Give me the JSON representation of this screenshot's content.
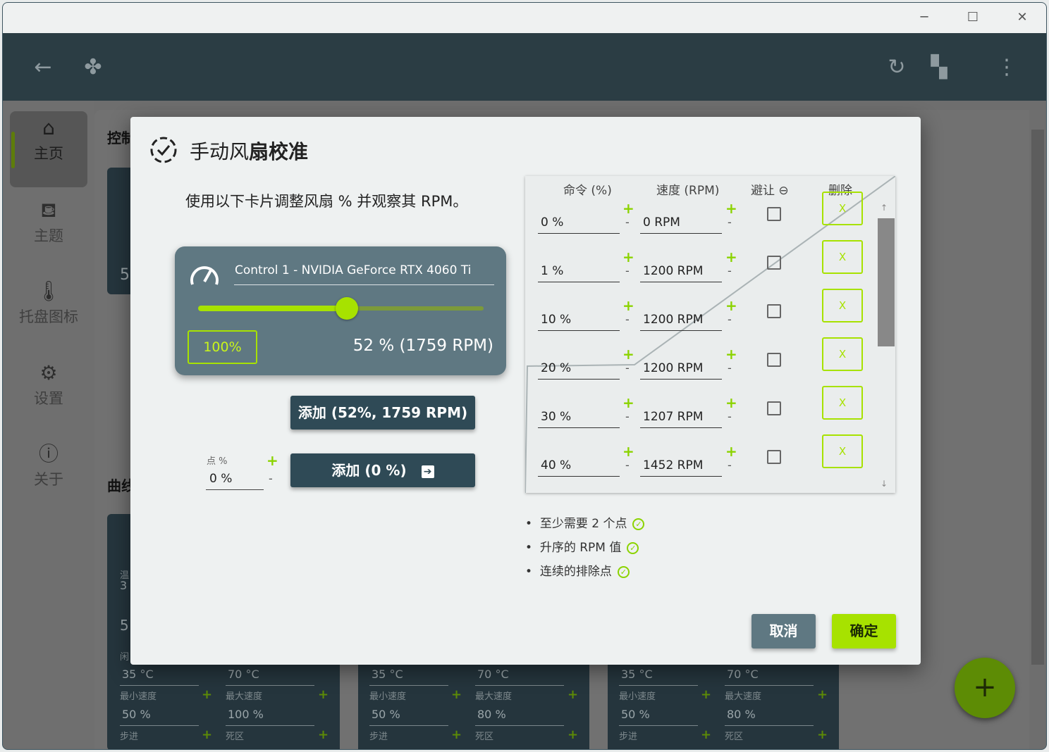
{
  "window": {
    "minimize_icon": "minimize-icon",
    "maximize_icon": "maximize-icon",
    "close_icon": "close-icon"
  },
  "appbar": {
    "back_icon": "arrow-left-icon",
    "app_icon": "fan-icon",
    "refresh_icon": "refresh-icon",
    "dashboard_icon": "dashboard-edit-icon",
    "more_icon": "more-vertical-icon"
  },
  "sidebar": {
    "items": [
      {
        "label": "主页",
        "icon": "home-icon",
        "active": true
      },
      {
        "label": "主题",
        "icon": "paint-bucket-icon"
      },
      {
        "label": "托盘图标",
        "icon": "thermometer-icon"
      },
      {
        "label": "设置",
        "icon": "gear-icon"
      },
      {
        "label": "关于",
        "icon": "info-icon"
      }
    ]
  },
  "background": {
    "section1": "控制",
    "section2": "曲线",
    "card_value": "5",
    "fan_cards": [
      {
        "temp_min": "35 °C",
        "temp_max": "70 °C",
        "min_speed_label": "最小速度",
        "max_speed_label": "最大速度",
        "min_speed": "50 %",
        "max_speed": "100 %",
        "step_label": "步进",
        "deadzone_label": "死区"
      },
      {
        "temp_min": "35 °C",
        "temp_max": "70 °C",
        "min_speed_label": "最小速度",
        "max_speed_label": "最大速度",
        "min_speed": "50 %",
        "max_speed": "80 %",
        "step_label": "步进",
        "deadzone_label": "死区"
      },
      {
        "temp_min": "35 °C",
        "temp_max": "70 °C",
        "min_speed_label": "最小速度",
        "max_speed_label": "最大速度",
        "min_speed": "50 %",
        "max_speed": "80 %",
        "step_label": "步进",
        "deadzone_label": "死区"
      }
    ],
    "left_card": {
      "temp_label": "温",
      "temp_value": "3",
      "value": "5",
      "idle_label": "闲"
    }
  },
  "dialog": {
    "title_light": "手动风",
    "title_bold": "扇校准",
    "icon": "calibration-check-icon",
    "intro": "使用以下卡片调整风扇 % 并观察其 RPM。",
    "control": {
      "icon": "speedometer-icon",
      "name": "Control 1 - NVIDIA GeForce RTX 4060 Ti",
      "slider_fraction": 0.52,
      "pct_button": "100%",
      "readout": "52 %  (1759 RPM)"
    },
    "add_current_button": "添加  (52%, 1759 RPM)",
    "point_label": "点 %",
    "point_value": "0 %",
    "add_point_button": "添加  (0 %)",
    "add_point_icon": "arrow-right-box-icon",
    "table": {
      "headers": {
        "cmd": "命令 (%)",
        "speed": "速度 (RPM)",
        "avoid": "避让",
        "avoid_icon": "minus-circle-icon",
        "delete": "删除"
      },
      "rows": [
        {
          "cmd": "0 %",
          "speed": "0 RPM",
          "delete": "X"
        },
        {
          "cmd": "1 %",
          "speed": "1200 RPM",
          "delete": "X"
        },
        {
          "cmd": "10 %",
          "speed": "1200 RPM",
          "delete": "X"
        },
        {
          "cmd": "20 %",
          "speed": "1200 RPM",
          "delete": "X"
        },
        {
          "cmd": "30 %",
          "speed": "1207 RPM",
          "delete": "X"
        },
        {
          "cmd": "40 %",
          "speed": "1452 RPM",
          "delete": "X"
        }
      ]
    },
    "rules": [
      "至少需要 2 个点",
      "升序的 RPM 值",
      "连续的排除点"
    ],
    "cancel": "取消",
    "ok": "确定"
  },
  "fab_icon": "plus-icon",
  "colors": {
    "accent": "#a7e200",
    "dark": "#2f4a56",
    "card": "#5f7882"
  }
}
